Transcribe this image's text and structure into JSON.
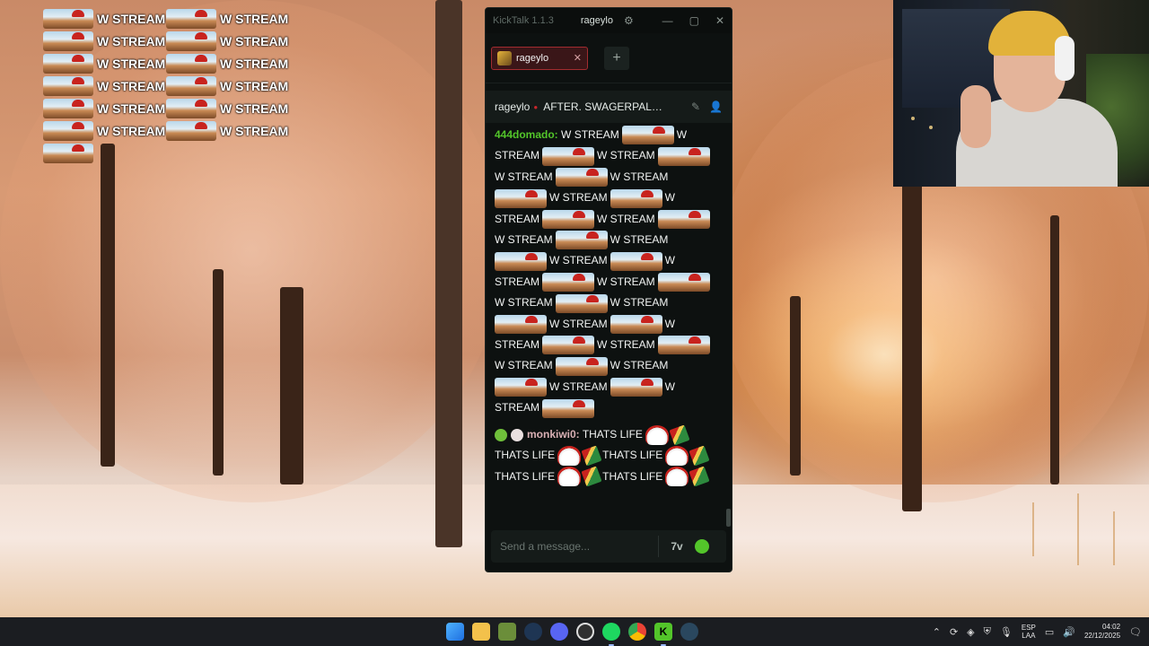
{
  "desktop": {
    "spam_text": "W STREAM",
    "spam_rows": 6,
    "spam_cols": 2
  },
  "kicktalk": {
    "app_name": "KickTalk 1.1.3",
    "title_user": "rageylo",
    "tab": {
      "label": "rageylo"
    },
    "add_tab_label": "+",
    "chat_header": {
      "user": "rageylo",
      "stream_title": "AFTER. SWAGERPALO..."
    },
    "messages": [
      {
        "username": "444domado:",
        "username_color": "#53c52a",
        "text": "W STREAM",
        "repeat": 22
      },
      {
        "username": "monkiwi0:",
        "username_color": "#d9b0b4",
        "text": "THATS LIFE",
        "repeat": 5
      }
    ],
    "input": {
      "placeholder": "Send a message..."
    },
    "icons": {
      "settings": "gear-icon",
      "minimize": "minimize-icon",
      "maximize": "maximize-icon",
      "close": "close-icon",
      "pin": "pin-icon",
      "user": "user-icon",
      "emote_picker": "kick-emote-icon",
      "seventv": "7tv-emote-icon"
    }
  },
  "taskbar": {
    "lang_top": "ESP",
    "lang_bottom": "LAA",
    "time": "04:02",
    "date": "22/12/2025"
  }
}
